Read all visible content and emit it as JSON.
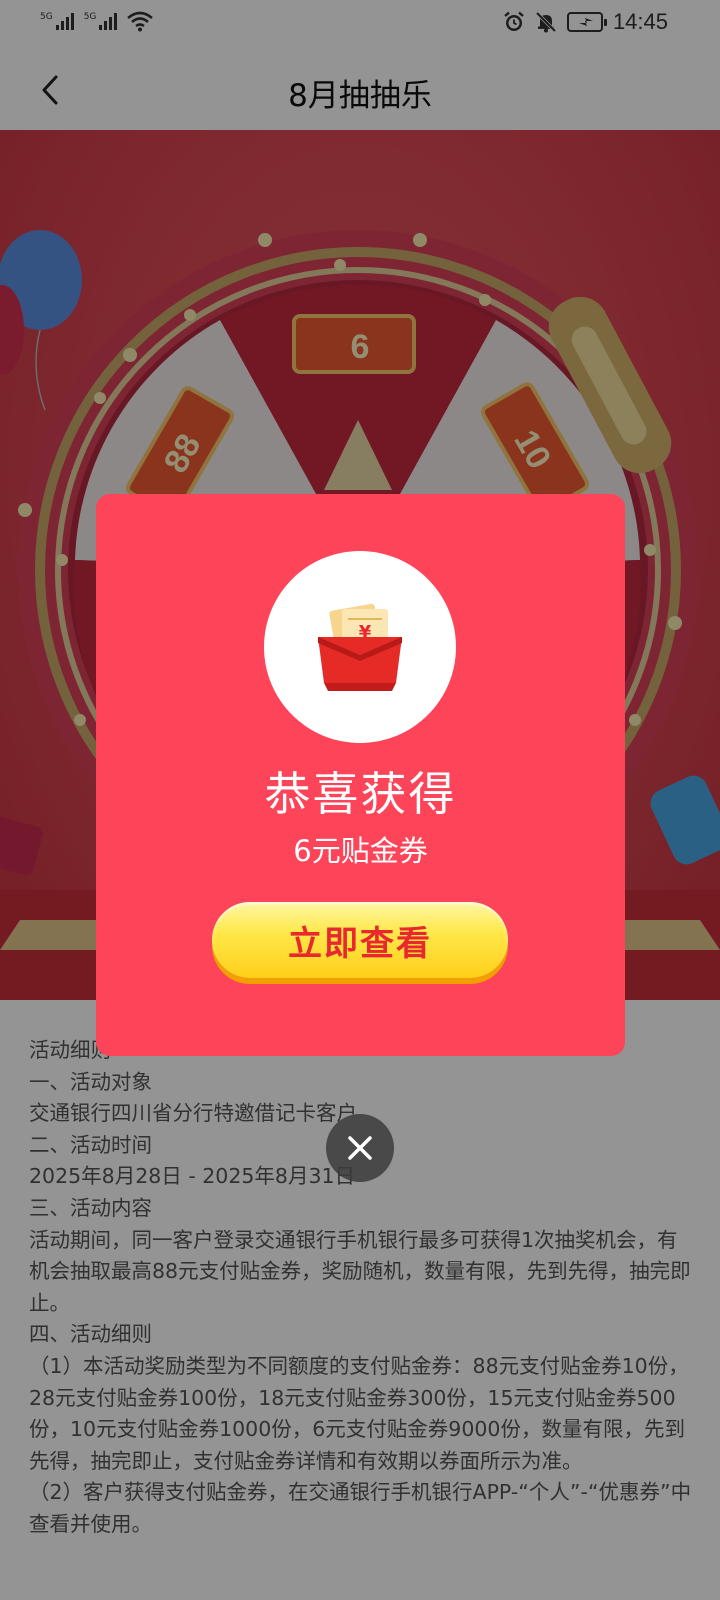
{
  "status_bar": {
    "time": "14:45",
    "sim1_tag": "5G",
    "sim2_tag": "5G",
    "icons": [
      "signal-icon",
      "wifi-icon",
      "alarm-icon",
      "mute-icon",
      "battery-charging-icon"
    ]
  },
  "header": {
    "title": "8月抽抽乐",
    "back_icon": "chevron-left-icon"
  },
  "wheel": {
    "prizes": [
      "6",
      "88",
      "10"
    ]
  },
  "modal": {
    "title": "恭喜获得",
    "prize": "6元贴金券",
    "button_label": "立即查看",
    "icon": "red-envelope-coupon-icon",
    "close_icon": "close-icon",
    "colors": {
      "background": "#fe4459",
      "button": "#ffd929",
      "button_text": "#e8272e"
    }
  },
  "rules": {
    "lines": [
      "活动细则",
      "一、活动对象",
      "交通银行四川省分行特邀借记卡客户",
      "二、活动时间",
      "2025年8月28日 - 2025年8月31日",
      "三、活动内容",
      "活动期间，同一客户登录交通银行手机银行最多可获得1次抽奖机会，有机会抽取最高88元支付贴金券，奖励随机，数量有限，先到先得，抽完即止。",
      "四、活动细则",
      "（1）本活动奖励类型为不同额度的支付贴金券：88元支付贴金券10份，28元支付贴金券100份，18元支付贴金券300份，15元支付贴金券500份，10元支付贴金券1000份，6元支付贴金券9000份，数量有限，先到先得，抽完即止，支付贴金券详情和有效期以券面所示为准。",
      "（2）客户获得支付贴金券，在交通银行手机银行APP-“个人”-“优惠券”中查看并使用。"
    ]
  }
}
